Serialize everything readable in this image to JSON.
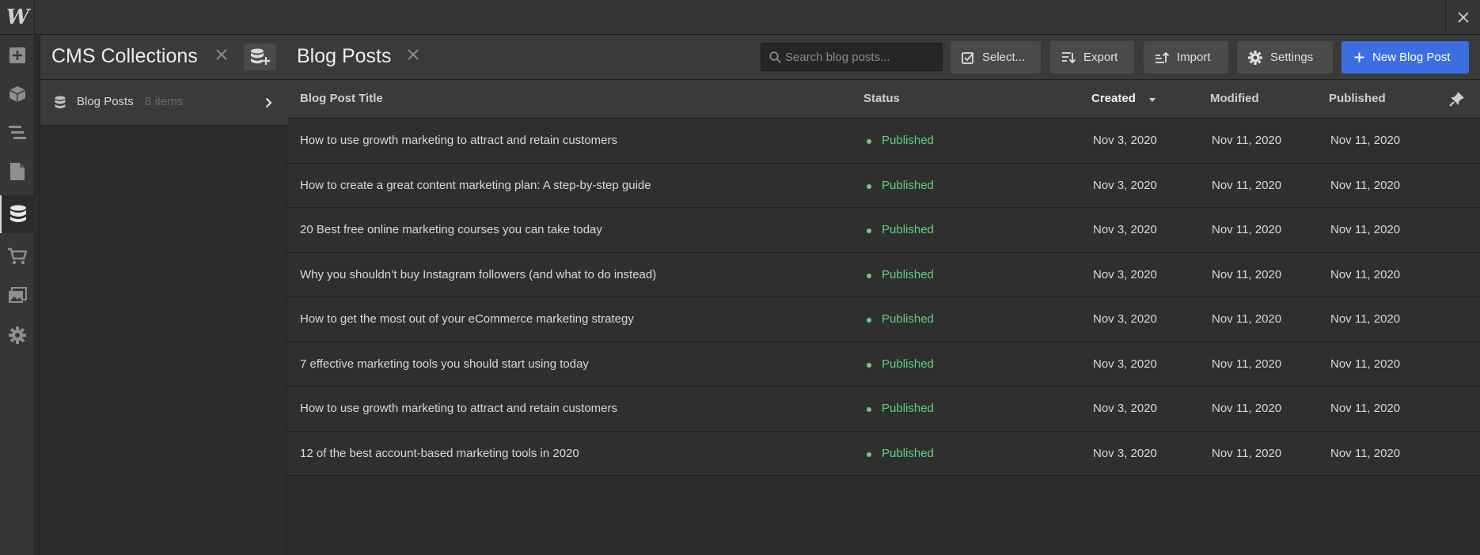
{
  "brand": {
    "logo_text": "W"
  },
  "sidebar": {
    "items": [
      {
        "icon": "add-icon"
      },
      {
        "icon": "box-icon"
      },
      {
        "icon": "navigator-icon"
      },
      {
        "icon": "pages-icon"
      },
      {
        "icon": "cms-database-icon",
        "active": true
      },
      {
        "icon": "ecommerce-cart-icon"
      },
      {
        "icon": "assets-images-icon"
      },
      {
        "icon": "settings-gear-icon"
      }
    ]
  },
  "collections_panel": {
    "title": "CMS Collections",
    "items": [
      {
        "label": "Blog Posts",
        "count": "8 items"
      }
    ]
  },
  "main": {
    "title": "Blog Posts",
    "search": {
      "placeholder": "Search blog posts..."
    },
    "toolbar": {
      "select_label": "Select...",
      "export_label": "Export",
      "import_label": "Import",
      "settings_label": "Settings",
      "new_label": "New Blog Post"
    },
    "columns": {
      "title": "Blog Post Title",
      "status": "Status",
      "created": "Created",
      "modified": "Modified",
      "published": "Published"
    },
    "rows": [
      {
        "title": "How to use growth marketing to attract and retain customers",
        "status": "Published",
        "created": "Nov 3, 2020",
        "modified": "Nov 11, 2020",
        "published": "Nov 11, 2020"
      },
      {
        "title": "How to create a great content marketing plan: A step-by-step guide",
        "status": "Published",
        "created": "Nov 3, 2020",
        "modified": "Nov 11, 2020",
        "published": "Nov 11, 2020"
      },
      {
        "title": "20 Best free online marketing courses you can take today",
        "status": "Published",
        "created": "Nov 3, 2020",
        "modified": "Nov 11, 2020",
        "published": "Nov 11, 2020"
      },
      {
        "title": "Why you shouldn’t buy Instagram followers (and what to do instead)",
        "status": "Published",
        "created": "Nov 3, 2020",
        "modified": "Nov 11, 2020",
        "published": "Nov 11, 2020"
      },
      {
        "title": "How to get the most out of your eCommerce marketing strategy",
        "status": "Published",
        "created": "Nov 3, 2020",
        "modified": "Nov 11, 2020",
        "published": "Nov 11, 2020"
      },
      {
        "title": "7 effective marketing tools you should start using today",
        "status": "Published",
        "created": "Nov 3, 2020",
        "modified": "Nov 11, 2020",
        "published": "Nov 11, 2020"
      },
      {
        "title": "How to use growth marketing to attract and retain customers",
        "status": "Published",
        "created": "Nov 3, 2020",
        "modified": "Nov 11, 2020",
        "published": "Nov 11, 2020"
      },
      {
        "title": "12 of the best account-based marketing tools in 2020",
        "status": "Published",
        "created": "Nov 3, 2020",
        "modified": "Nov 11, 2020",
        "published": "Nov 11, 2020"
      }
    ]
  },
  "colors": {
    "accent": "#3b6fe0",
    "status_published": "#5fd27c",
    "background": "#2b2b2b",
    "panel": "#3a3a3a"
  }
}
